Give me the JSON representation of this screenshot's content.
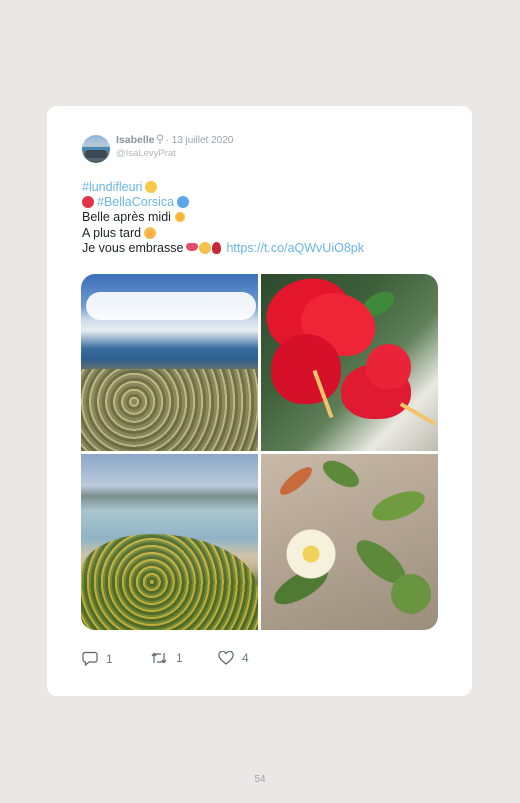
{
  "post": {
    "author_name": "Isabelle",
    "date": "· 13 juillet 2020",
    "handle": "@IsaLevyPrat",
    "hashtag1": "#lundifleuri",
    "hashtag2": "#BellaCorsica",
    "line3": "Belle après midi",
    "line4": "A plus tard",
    "line5": "Je vous embrasse",
    "link": "https://t.co/aQWvUiO8pk"
  },
  "actions": {
    "replies": "1",
    "retweets": "1",
    "likes": "4"
  },
  "page_number": "54",
  "icons": [
    "pin-icon",
    "yellow-heart-icon",
    "red-heart-icon",
    "blue-heart-icon",
    "sun-icon",
    "smile-icon",
    "lips-icon",
    "kiss-icon",
    "rose-icon",
    "reply-icon",
    "retweet-icon",
    "like-icon"
  ],
  "colors": {
    "background": "#ece7e7",
    "card": "#ffffff",
    "link": "#6ab6e5",
    "text": "#1f2328"
  }
}
